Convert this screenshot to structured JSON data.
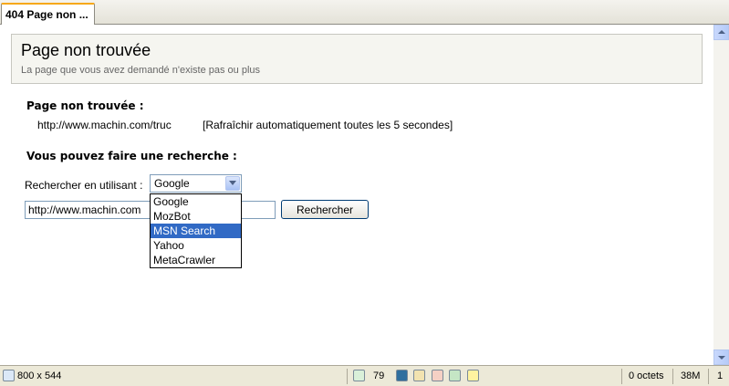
{
  "tab": {
    "title": "404 Page non ..."
  },
  "header": {
    "title": "Page non trouvée",
    "subtitle": "La page que vous avez demandé n'existe pas ou plus"
  },
  "not_found": {
    "heading": "Page non trouvée :",
    "url": "http://www.machin.com/truc",
    "refresh_note": "[Rafraîchir automatiquement toutes les 5 secondes]"
  },
  "search": {
    "heading": "Vous pouvez faire une recherche :",
    "engine_label": "Rechercher en utilisant :",
    "engine_selected": "Google",
    "input_value": "http://www.machin.com",
    "button_label": "Rechercher",
    "options": [
      "Google",
      "MozBot",
      "MSN Search",
      "Yahoo",
      "MetaCrawler"
    ],
    "highlighted_option": "MSN Search"
  },
  "statusbar": {
    "dimensions": "800 x 544",
    "count": "79",
    "bytes": "0 octets",
    "memory": "38M",
    "extra": "1"
  },
  "colors": {
    "selection": "#316ac5",
    "tab_accent": "#f6a81a"
  }
}
